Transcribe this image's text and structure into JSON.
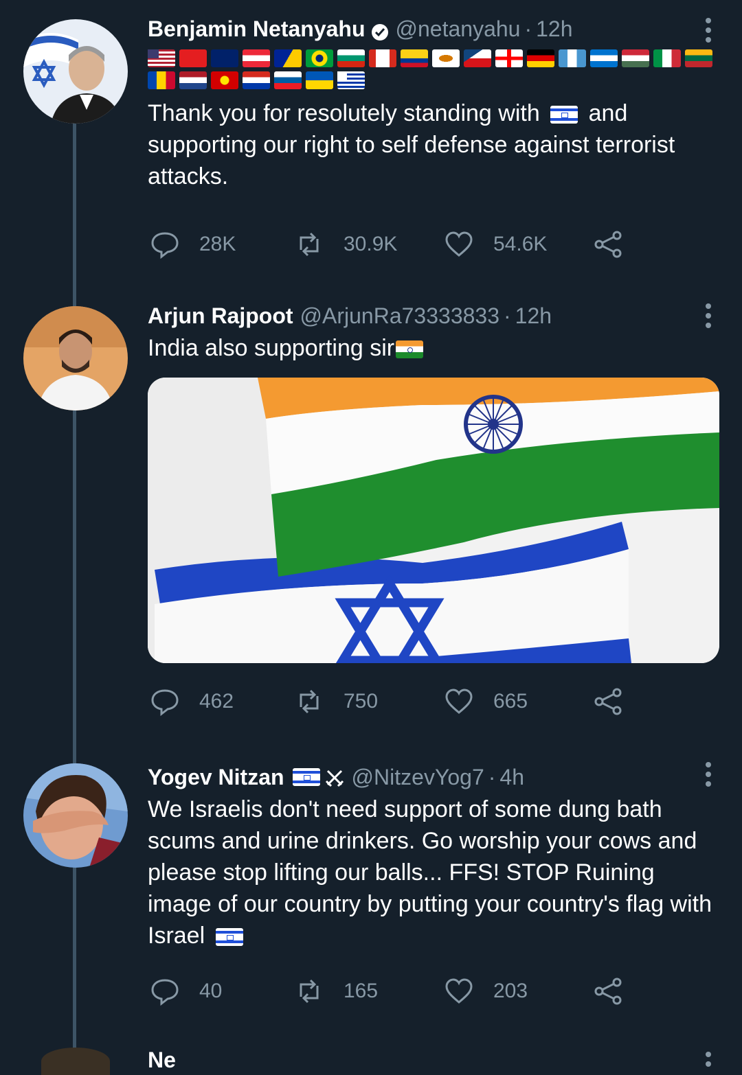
{
  "tweets": [
    {
      "name": "Benjamin Netanyahu",
      "verified": true,
      "handle": "@netanyahu",
      "time": "12h",
      "text_before_flag": "Thank you for resolutely standing with",
      "text_after_flag": "and supporting our right to self defense against terrorist attacks.",
      "flags": [
        "United States",
        "Albania",
        "Australia",
        "Austria",
        "Bosnia and Herzegovina",
        "Brazil",
        "Bulgaria",
        "Canada",
        "Colombia",
        "Cyprus",
        "Czech Republic",
        "Georgia",
        "Germany",
        "Guatemala",
        "Honduras",
        "Hungary",
        "Italy",
        "Lithuania",
        "Moldova",
        "Netherlands",
        "North Macedonia",
        "Paraguay",
        "Slovenia",
        "Ukraine",
        "Uruguay"
      ],
      "replies": "28K",
      "retweets": "30.9K",
      "likes": "54.6K"
    },
    {
      "name": "Arjun Rajpoot",
      "handle": "@ArjunRa73333833",
      "time": "12h",
      "text": "India also supporting sir",
      "replies": "462",
      "retweets": "750",
      "likes": "665"
    },
    {
      "name": "Yogev Nitzan",
      "handle": "@NitzevYog7",
      "time": "4h",
      "text_main": "We Israelis don't need support of some dung bath scums and urine drinkers. Go worship your cows and please stop lifting our balls... FFS! STOP Ruining image of our country by putting your country's flag with Israel",
      "replies": "40",
      "retweets": "165",
      "likes": "203"
    }
  ],
  "peek": {
    "name": "Ne"
  },
  "colors": {
    "background": "#15202b",
    "secondary_text": "#8899a6",
    "thread_line": "#3d5466"
  },
  "icons": [
    "verified-icon",
    "more-icon",
    "reply-icon",
    "retweet-icon",
    "like-icon",
    "share-icon",
    "swords-icon"
  ]
}
